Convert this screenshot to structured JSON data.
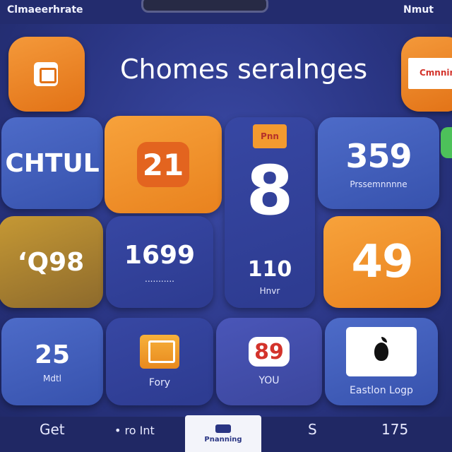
{
  "status_bar": {
    "left": "Clmaeerhrate",
    "right": "Nmut"
  },
  "header": {
    "title": "Chomes seralnges"
  },
  "corner_right_label": "Cmnnin",
  "tiles": {
    "chtul": "CHTUL",
    "orange_num": "21",
    "tall_tag": "Pnn",
    "tall_big": "8",
    "tall_num": "110",
    "tall_sub": "Hnvr",
    "n359": "359",
    "n359_sub": "Prssemnnnne",
    "gold": "‘Q98",
    "n1699": "1699",
    "n1699_sub": "...........",
    "n49": "49",
    "n25": "25",
    "n25_sub": "Mdtl",
    "fory_sub": "Fory",
    "you_icon": "89",
    "you_sub": "YOU",
    "apple_sub": "Eastlon Logp"
  },
  "bottom_tabs": {
    "get": "Get",
    "fonit": "• ro Int",
    "active": "Pnanning",
    "s": "S",
    "n175": "175"
  }
}
